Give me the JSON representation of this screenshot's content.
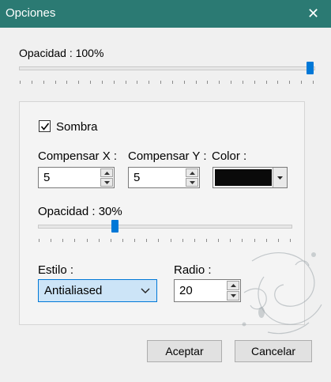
{
  "window": {
    "title": "Opciones",
    "close_glyph": "✕"
  },
  "opacity": {
    "label": "Opacidad : 100%",
    "value_percent": 100
  },
  "shadow": {
    "checkbox_label": "Sombra",
    "checked": true,
    "offset_x": {
      "label": "Compensar X :",
      "value": "5"
    },
    "offset_y": {
      "label": "Compensar Y :",
      "value": "5"
    },
    "color": {
      "label": "Color :",
      "value": "#0a0a0a"
    },
    "opacity": {
      "label": "Opacidad : 30%",
      "value_percent": 30
    },
    "style": {
      "label": "Estilo :",
      "value": "Antialiased"
    },
    "radius": {
      "label": "Radio :",
      "value": "20"
    }
  },
  "buttons": {
    "accept": "Aceptar",
    "cancel": "Cancelar"
  },
  "icons": {
    "close": "close-icon",
    "check": "check-icon",
    "spin_up": "arrow-up-icon",
    "spin_down": "arrow-down-icon",
    "chevron": "chevron-down-icon"
  },
  "colors": {
    "titlebar": "#2b7a73",
    "accent": "#0078d7",
    "selection": "#cce4f7"
  }
}
